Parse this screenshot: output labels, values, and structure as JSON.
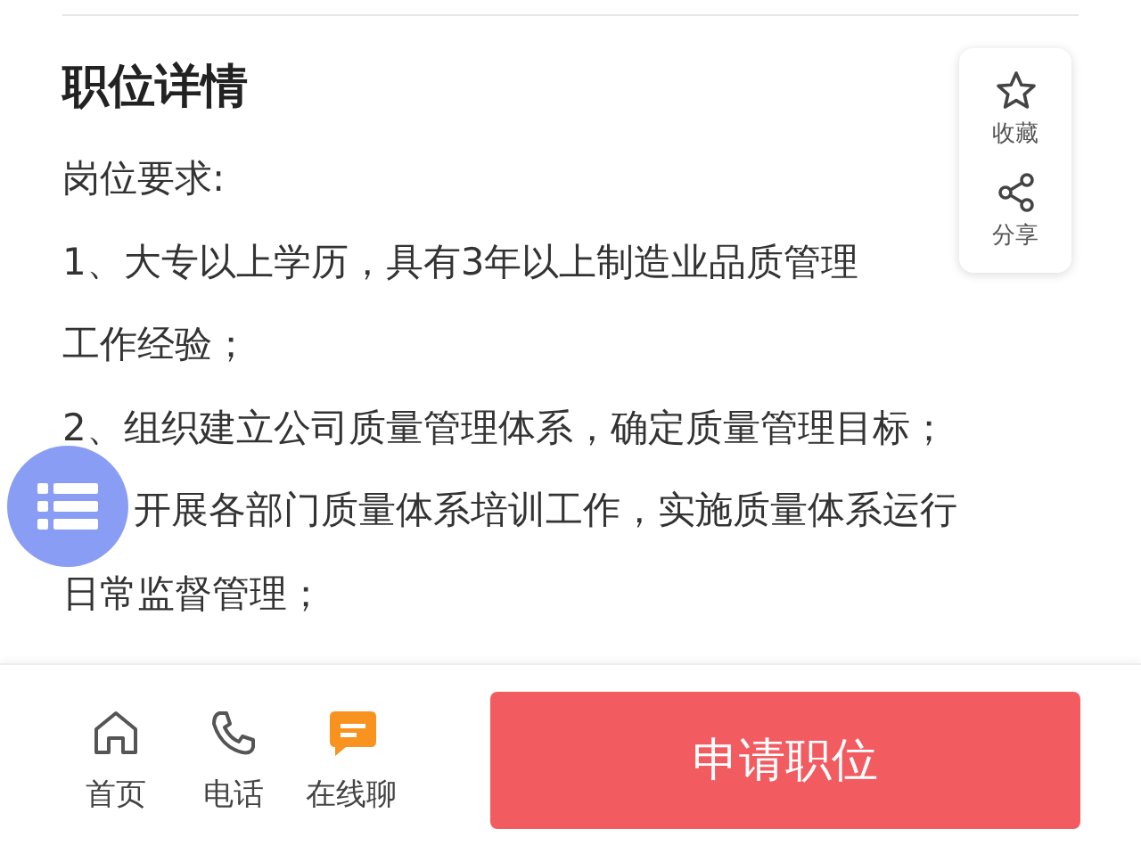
{
  "section_title": "职位详情",
  "lines": [
    {
      "text": "岗位要求:"
    },
    {
      "text": "1、大专以上学历，具有3年以上制造业品质管理"
    },
    {
      "text": "工作经验；"
    },
    {
      "text": "2、组织建立公司质量管理体系，确定质量管理目标；"
    },
    {
      "text": "开展各部门质量体系培训工作，实施质量体系运行",
      "indent": true
    },
    {
      "text": "日常监督管理；"
    }
  ],
  "float_actions": [
    {
      "kind": "favorite",
      "label": "收藏"
    },
    {
      "kind": "share",
      "label": "分享"
    }
  ],
  "bottom_nav": [
    {
      "kind": "home",
      "label": "首页"
    },
    {
      "kind": "phone",
      "label": "电话"
    },
    {
      "kind": "chat",
      "label": "在线聊"
    }
  ],
  "apply_button": "申请职位"
}
